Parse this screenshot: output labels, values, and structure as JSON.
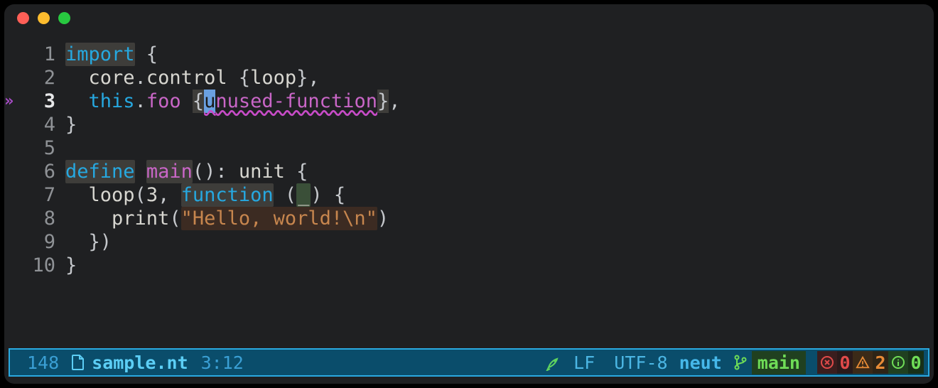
{
  "window": {
    "os_buttons": [
      "close",
      "minimize",
      "maximize"
    ]
  },
  "editor": {
    "active_line": 3,
    "cursor": {
      "line": 3,
      "col": 12
    },
    "lines": [
      {
        "n": 1,
        "tokens": [
          {
            "t": "import",
            "c": "kw idbg"
          },
          {
            "t": " {",
            "c": "punc"
          }
        ]
      },
      {
        "n": 2,
        "tokens": [
          {
            "t": "  core",
            "c": "type"
          },
          {
            "t": ".",
            "c": "punc"
          },
          {
            "t": "control ",
            "c": "type"
          },
          {
            "t": "{",
            "c": "punc"
          },
          {
            "t": "loop",
            "c": "type"
          },
          {
            "t": "},",
            "c": "punc"
          }
        ]
      },
      {
        "n": 3,
        "marker": "dbl-chevron",
        "tokens": [
          {
            "t": "  ",
            "c": ""
          },
          {
            "t": "this",
            "c": "kw"
          },
          {
            "t": ".",
            "c": "punc"
          },
          {
            "t": "foo ",
            "c": "ident"
          },
          {
            "t": "{",
            "c": "brace-hl"
          },
          {
            "t": "u",
            "c": "warncursor"
          },
          {
            "t": "nused-function",
            "c": "warnspan"
          },
          {
            "t": "}",
            "c": "brace-hl"
          },
          {
            "t": ",",
            "c": "punc"
          }
        ]
      },
      {
        "n": 4,
        "tokens": [
          {
            "t": "}",
            "c": "punc"
          }
        ]
      },
      {
        "n": 5,
        "tokens": [
          {
            "t": "",
            "c": ""
          }
        ]
      },
      {
        "n": 6,
        "tokens": [
          {
            "t": "define",
            "c": "kw idbg"
          },
          {
            "t": " ",
            "c": ""
          },
          {
            "t": "main",
            "c": "ident idbg"
          },
          {
            "t": "(): ",
            "c": "punc"
          },
          {
            "t": "unit ",
            "c": "type"
          },
          {
            "t": "{",
            "c": "punc"
          }
        ]
      },
      {
        "n": 7,
        "tokens": [
          {
            "t": "  loop",
            "c": "type"
          },
          {
            "t": "(",
            "c": "punc"
          },
          {
            "t": "3",
            "c": "type"
          },
          {
            "t": ", ",
            "c": "punc"
          },
          {
            "t": "function",
            "c": "kw idbg"
          },
          {
            "t": " (",
            "c": "punc"
          },
          {
            "t": "_",
            "c": "param"
          },
          {
            "t": ") {",
            "c": "punc"
          }
        ]
      },
      {
        "n": 8,
        "tokens": [
          {
            "t": "    print",
            "c": "type"
          },
          {
            "t": "(",
            "c": "punc"
          },
          {
            "t": "\"Hello, world!\\n\"",
            "c": "str"
          },
          {
            "t": ")",
            "c": "punc"
          }
        ]
      },
      {
        "n": 9,
        "tokens": [
          {
            "t": "  })",
            "c": "punc"
          }
        ]
      },
      {
        "n": 10,
        "tokens": [
          {
            "t": "}",
            "c": "punc"
          }
        ]
      }
    ]
  },
  "status": {
    "id": "148",
    "file": "sample.nt",
    "pos": "3:12",
    "lsp_ready": "rocket",
    "eol": "LF",
    "encoding": "UTF-8",
    "language": "neut",
    "vcs_branch": "main",
    "diagnostics": {
      "errors": 0,
      "warnings": 2,
      "info": 0
    }
  }
}
